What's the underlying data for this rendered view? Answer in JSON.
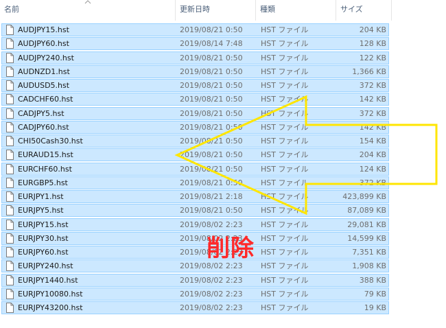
{
  "columns": {
    "name": "名前",
    "date": "更新日時",
    "type": "種類",
    "size": "サイズ"
  },
  "files": [
    {
      "name": "AUDJPY15.hst",
      "date": "2019/08/21 0:50",
      "type": "HST ファイル",
      "size": "204 KB"
    },
    {
      "name": "AUDJPY60.hst",
      "date": "2019/08/14 7:48",
      "type": "HST ファイル",
      "size": "128 KB"
    },
    {
      "name": "AUDJPY240.hst",
      "date": "2019/08/21 0:50",
      "type": "HST ファイル",
      "size": "122 KB"
    },
    {
      "name": "AUDNZD1.hst",
      "date": "2019/08/21 0:50",
      "type": "HST ファイル",
      "size": "1,366 KB"
    },
    {
      "name": "AUDUSD5.hst",
      "date": "2019/08/21 0:50",
      "type": "HST ファイル",
      "size": "372 KB"
    },
    {
      "name": "CADCHF60.hst",
      "date": "2019/08/21 0:50",
      "type": "HST ファイル",
      "size": "142 KB"
    },
    {
      "name": "CADJPY5.hst",
      "date": "2019/08/21 0:50",
      "type": "HST ファイル",
      "size": "372 KB"
    },
    {
      "name": "CADJPY60.hst",
      "date": "2019/08/21 0:50",
      "type": "HST ファイル",
      "size": "142 KB"
    },
    {
      "name": "CHI50Cash30.hst",
      "date": "2019/08/21 0:50",
      "type": "HST ファイル",
      "size": "154 KB"
    },
    {
      "name": "EURAUD15.hst",
      "date": "2019/08/21 0:50",
      "type": "HST ファイル",
      "size": "204 KB"
    },
    {
      "name": "EURCHF60.hst",
      "date": "2019/08/21 0:50",
      "type": "HST ファイル",
      "size": "124 KB"
    },
    {
      "name": "EURGBP5.hst",
      "date": "2019/08/21 0:50",
      "type": "HST ファイル",
      "size": "372 KB"
    },
    {
      "name": "EURJPY1.hst",
      "date": "2019/08/21 2:18",
      "type": "HST ファイル",
      "size": "423,899 KB"
    },
    {
      "name": "EURJPY5.hst",
      "date": "2019/08/21 0:50",
      "type": "HST ファイル",
      "size": "87,089 KB"
    },
    {
      "name": "EURJPY15.hst",
      "date": "2019/08/02 2:23",
      "type": "HST ファイル",
      "size": "29,081 KB"
    },
    {
      "name": "EURJPY30.hst",
      "date": "2019/08/02 2:23",
      "type": "HST ファイル",
      "size": "14,599 KB"
    },
    {
      "name": "EURJPY60.hst",
      "date": "2019/08/02 2:23",
      "type": "HST ファイル",
      "size": "7,351 KB"
    },
    {
      "name": "EURJPY240.hst",
      "date": "2019/08/02 2:23",
      "type": "HST ファイル",
      "size": "1,908 KB"
    },
    {
      "name": "EURJPY1440.hst",
      "date": "2019/08/02 2:23",
      "type": "HST ファイル",
      "size": "388 KB"
    },
    {
      "name": "EURJPY10080.hst",
      "date": "2019/08/02 2:23",
      "type": "HST ファイル",
      "size": "79 KB"
    },
    {
      "name": "EURJPY43200.hst",
      "date": "2019/08/02 2:23",
      "type": "HST ファイル",
      "size": "19 KB"
    }
  ],
  "annotation": {
    "label": "削除",
    "label_color": "#ff2a2a",
    "arrow_color": "#ffe600",
    "arrow_direction": "left"
  },
  "colors": {
    "selection_fill": "#cce8ff",
    "selection_border": "#99d1ff",
    "header_text": "#4c607a"
  },
  "icons": {
    "sort": "sort-up-icon",
    "file": "file-icon"
  }
}
